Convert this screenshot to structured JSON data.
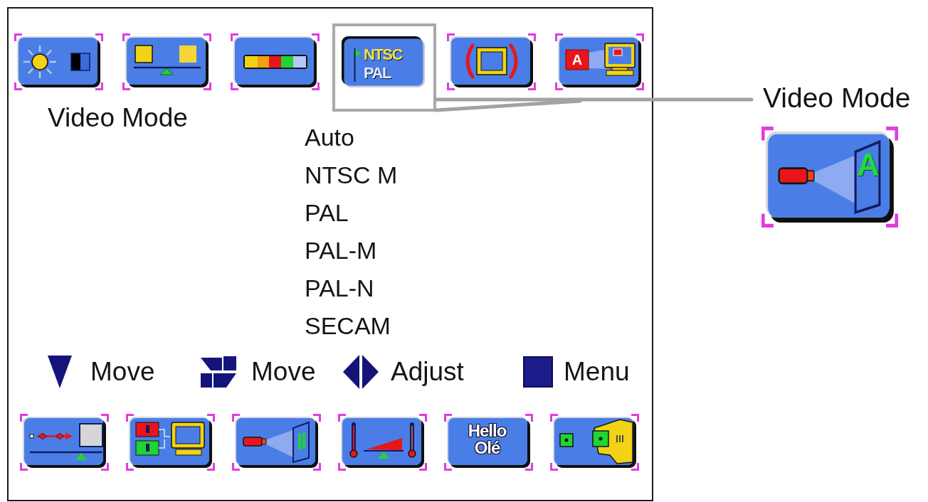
{
  "top_icons": [
    {
      "kind": "sun-contrast",
      "selected": false
    },
    {
      "kind": "balance",
      "selected": false
    },
    {
      "kind": "color-bar",
      "selected": false
    },
    {
      "kind": "ntsc-pal",
      "selected": true,
      "lines": [
        "NTSC",
        "PAL"
      ]
    },
    {
      "kind": "screen-size",
      "selected": false
    },
    {
      "kind": "letter-monitor",
      "selected": false,
      "lines": [
        "A"
      ]
    }
  ],
  "menu": {
    "title": "Video Mode",
    "options": [
      "Auto",
      "NTSC M",
      "PAL",
      "PAL-M",
      "PAL-N",
      "SECAM"
    ]
  },
  "hints": [
    {
      "kind": "down",
      "label": "Move"
    },
    {
      "kind": "blocks",
      "label": "Move"
    },
    {
      "kind": "left-right",
      "label": "Adjust"
    },
    {
      "kind": "square",
      "label": "Menu"
    }
  ],
  "bottom_icons": [
    {
      "kind": "arrow-balance",
      "selected": false
    },
    {
      "kind": "inputs-monitor",
      "selected": false
    },
    {
      "kind": "projector",
      "selected": false
    },
    {
      "kind": "thermo-balance",
      "selected": false
    },
    {
      "kind": "language",
      "selected": false,
      "lines": [
        "Hello",
        "Olé"
      ]
    },
    {
      "kind": "wrench",
      "selected": false
    }
  ],
  "callout": {
    "label": "Video Mode",
    "icon": {
      "kind": "projector",
      "lines": [
        "A"
      ]
    }
  }
}
